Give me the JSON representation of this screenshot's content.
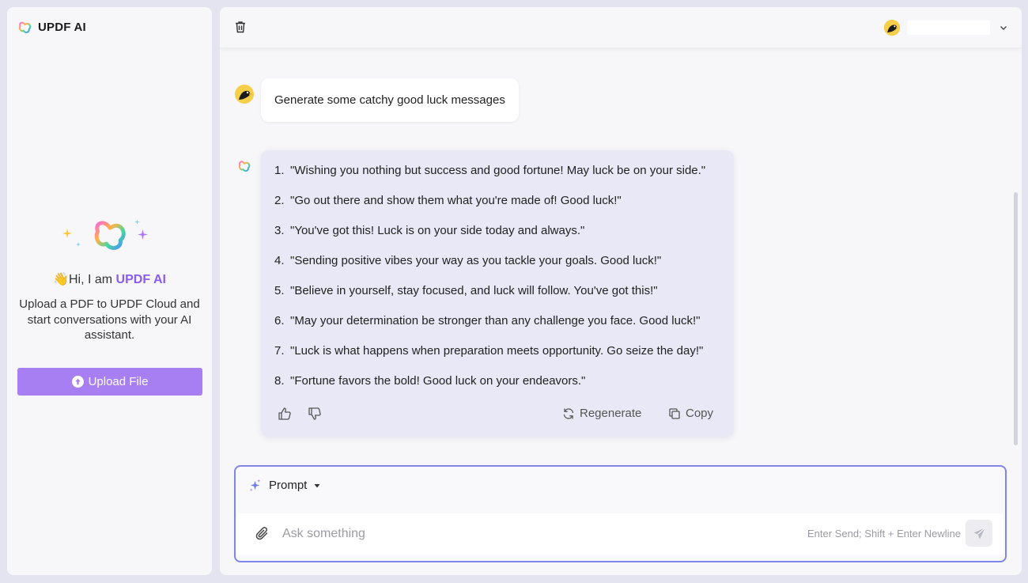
{
  "sidebar": {
    "brand_name": "UPDF AI",
    "greeting_emoji": "👋",
    "greeting_prefix": "Hi, I am ",
    "greeting_brand": "UPDF AI",
    "intro_text": "Upload a PDF to UPDF Cloud and start conversations with your AI assistant.",
    "upload_label": "Upload File"
  },
  "topbar": {
    "trash_icon": "trash-icon",
    "user_name": ""
  },
  "chat": {
    "user_message": "Generate some catchy good luck messages",
    "ai_items": [
      {
        "num": "1.",
        "text": "\"Wishing you nothing but success and good fortune! May luck be on your side.\""
      },
      {
        "num": "2.",
        "text": "\"Go out there and show them what you're made of! Good luck!\""
      },
      {
        "num": "3.",
        "text": "\"You've got this! Luck is on your side today and always.\""
      },
      {
        "num": "4.",
        "text": "\"Sending positive vibes your way as you tackle your goals. Good luck!\""
      },
      {
        "num": "5.",
        "text": "\"Believe in yourself, stay focused, and luck will follow. You've got this!\""
      },
      {
        "num": "6.",
        "text": "\"May your determination be stronger than any challenge you face. Good luck!\""
      },
      {
        "num": "7.",
        "text": "\"Luck is what happens when preparation meets opportunity. Go seize the day!\""
      },
      {
        "num": "8.",
        "text": "\"Fortune favors the bold! Good luck on your endeavors.\""
      }
    ],
    "regenerate_label": "Regenerate",
    "copy_label": "Copy"
  },
  "composer": {
    "prompt_label": "Prompt",
    "input_placeholder": "Ask something",
    "input_value": "",
    "hint": "Enter Send; Shift + Enter Newline"
  },
  "colors": {
    "accent_purple": "#a77ff2",
    "brand_text": "#8a5cf0",
    "composer_border": "#8086e6",
    "ai_bubble": "#e8e8f6"
  }
}
